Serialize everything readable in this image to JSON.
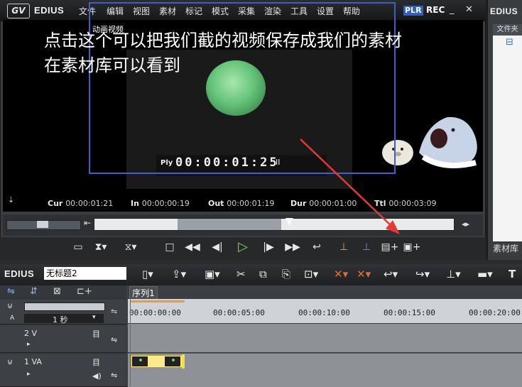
{
  "player": {
    "brand": "EDIUS",
    "logo": "GV",
    "menu": [
      "文件",
      "编辑",
      "视图",
      "素材",
      "标记",
      "模式",
      "采集",
      "渲染",
      "工具",
      "设置",
      "帮助"
    ],
    "plr": "PLR",
    "rec": "REC",
    "clip_name": "动画视频",
    "annotation": "点击这个可以把我们截的视频保存成我们的素材\n在素材库可以看到",
    "timecode_label": "Ply",
    "timecode": "00:00:01:25",
    "timecode_suffix": "II",
    "status": {
      "cur_label": "Cur",
      "cur": "00:00:01:21",
      "in_label": "In",
      "in": "00:00:00:19",
      "out_label": "Out",
      "out": "00:00:01:19",
      "dur_label": "Dur",
      "dur": "00:00:01:00",
      "ttl_label": "Ttl",
      "ttl": "00:00:03:09"
    }
  },
  "bin": {
    "brand": "EDIUS",
    "folder_tab": "文件夹",
    "library_label": "素材库"
  },
  "timeline": {
    "brand": "EDIUS",
    "project_name": "无标题2",
    "sequence_tab": "序列1",
    "scale": "1 秒",
    "ruler": [
      "00:00:00:00",
      "00:00:05:00",
      "00:00:10:00",
      "00:00:15:00",
      "00:00:20:00"
    ],
    "tracks": [
      {
        "name": "2 V"
      },
      {
        "name": "1 VA"
      }
    ],
    "track_letter": "A"
  },
  "colors": {
    "frame_border": "#3f5fd0",
    "arrow": "#e53935",
    "play_green": "#7ed957",
    "clip_yellow": "#fbe98c"
  }
}
